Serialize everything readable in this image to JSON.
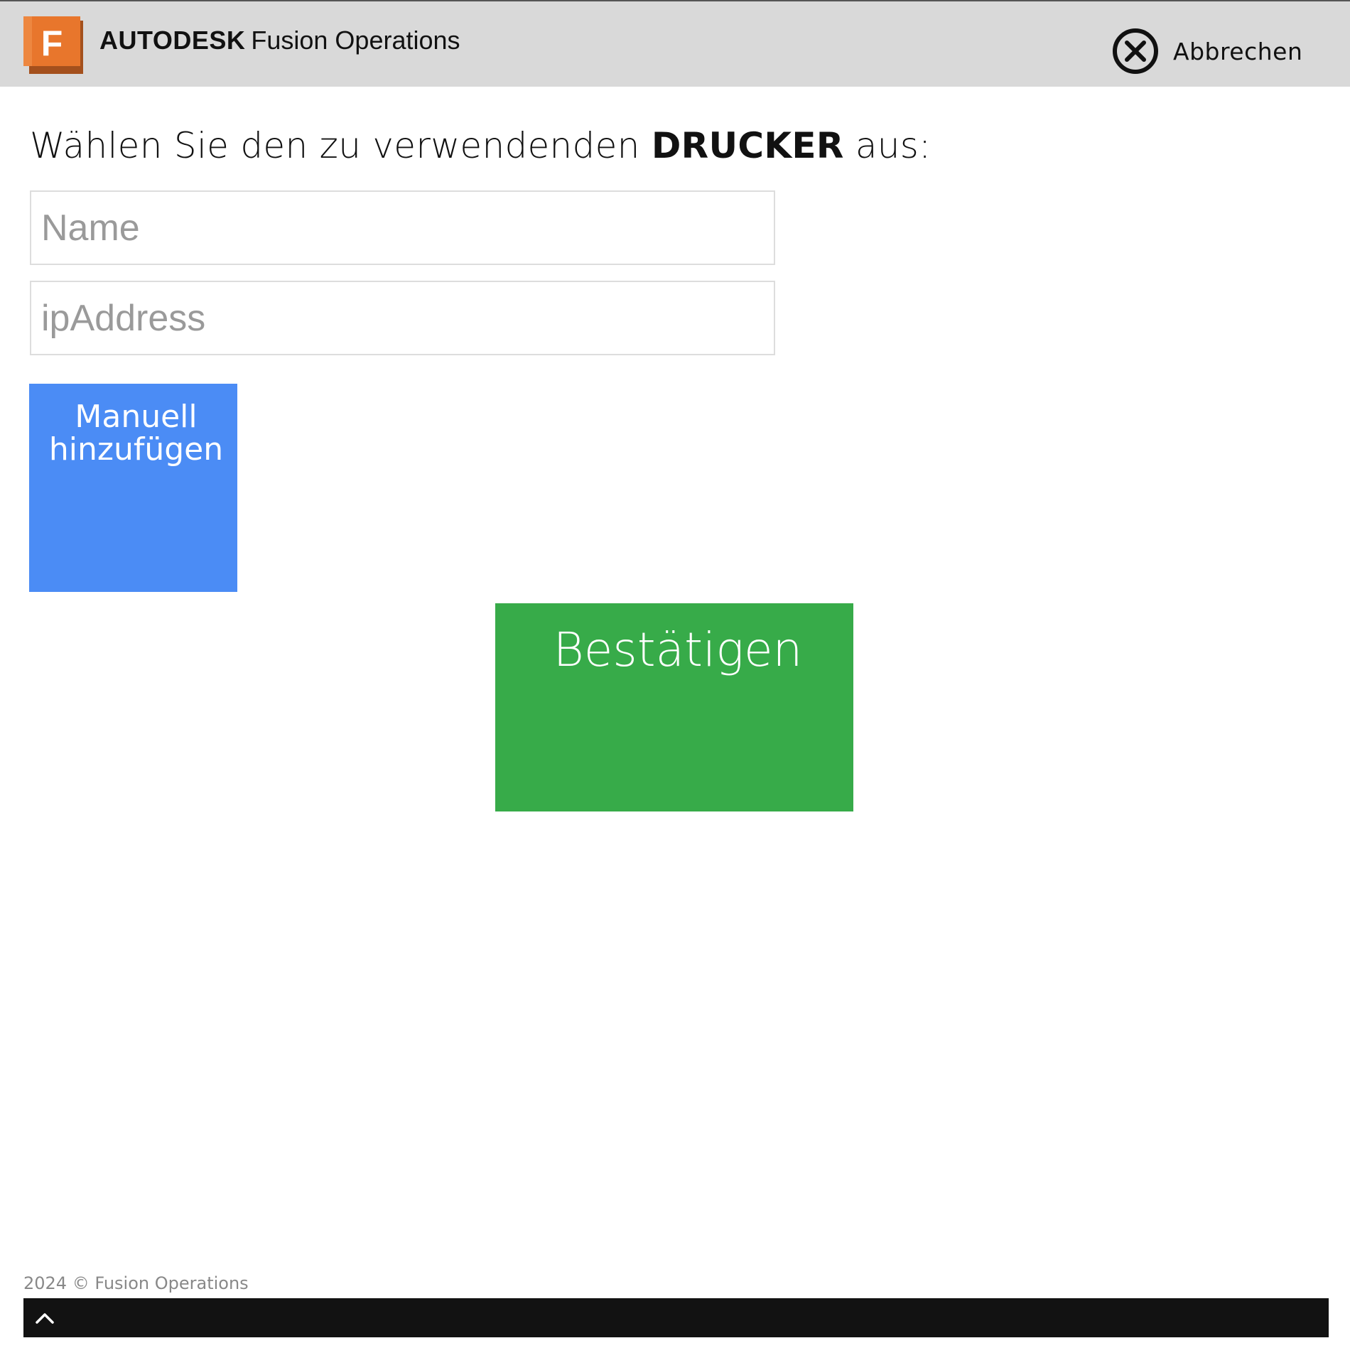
{
  "header": {
    "brand_primary": "AUTODESK",
    "brand_secondary": "Fusion Operations",
    "logo_letter": "F",
    "logo_icon": "fusion-operations-logo",
    "cancel_label": "Abbrechen",
    "cancel_icon": "close-circle-icon"
  },
  "main": {
    "prompt_before": "Wählen Sie den zu verwendenden",
    "prompt_bold": "DRUCKER",
    "prompt_after": "aus:",
    "name_placeholder": "Name",
    "name_value": "",
    "ip_placeholder": "ipAddress",
    "ip_value": "",
    "manual_add_line1": "Manuell",
    "manual_add_line2": "hinzufügen",
    "confirm_label": "Bestätigen"
  },
  "footer": {
    "copyright": "2024 © Fusion Operations",
    "scroll_icon": "chevron-up-icon"
  },
  "colors": {
    "header_bg": "#d9d9d9",
    "logo_orange": "#e8762c",
    "logo_shadow": "#a4501d",
    "manual_button": "#4b8cf5",
    "confirm_button": "#37ab49",
    "footer_bar": "#121212"
  }
}
